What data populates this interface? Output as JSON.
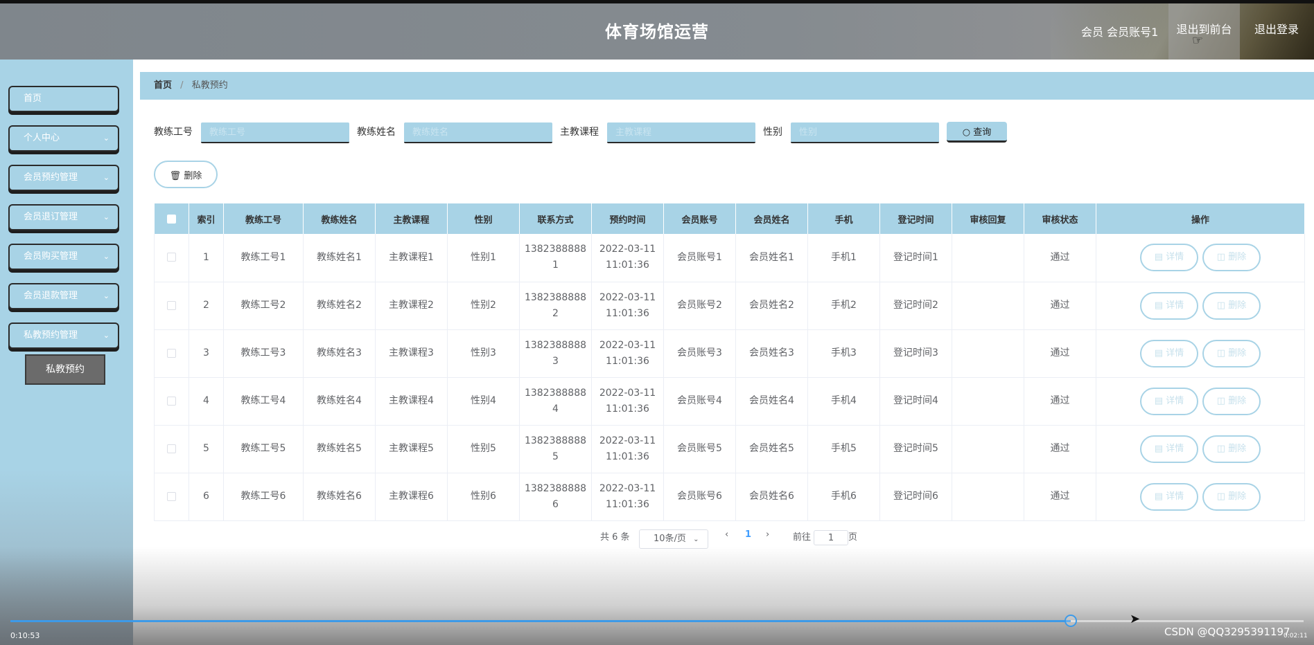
{
  "header": {
    "title": "体育场馆运营",
    "user_label": "会员 会员账号1",
    "front_label": "退出到前台",
    "logout_label": "退出登录"
  },
  "sidebar": {
    "items": [
      {
        "label": "首页"
      },
      {
        "label": "个人中心"
      },
      {
        "label": "会员预约管理"
      },
      {
        "label": "会员退订管理"
      },
      {
        "label": "会员购买管理"
      },
      {
        "label": "会员退款管理"
      },
      {
        "label": "私教预约管理"
      }
    ],
    "active_sub": "私教预约"
  },
  "breadcrumb": {
    "home": "首页",
    "separator": "/",
    "current": "私教预约"
  },
  "search": {
    "fields": [
      {
        "label": "教练工号",
        "placeholder": "教练工号"
      },
      {
        "label": "教练姓名",
        "placeholder": "教练姓名"
      },
      {
        "label": "主教课程",
        "placeholder": "主教课程"
      },
      {
        "label": "性别",
        "placeholder": "性别"
      }
    ],
    "query_label": "查询",
    "delete_label": "删除"
  },
  "table": {
    "headers": [
      "索引",
      "教练工号",
      "教练姓名",
      "主教课程",
      "性别",
      "联系方式",
      "预约时间",
      "会员账号",
      "会员姓名",
      "手机",
      "登记时间",
      "审核回复",
      "审核状态",
      "操作"
    ],
    "rows": [
      {
        "idx": "1",
        "no": "教练工号1",
        "name": "教练姓名1",
        "course": "主教课程1",
        "sex": "性别1",
        "phone_a": "1382388888",
        "phone_b": "1",
        "date": "2022-03-11",
        "time": "11:01:36",
        "acct": "会员账号1",
        "mname": "会员姓名1",
        "mobile": "手机1",
        "reg": "登记时间1",
        "reply": "",
        "status": "通过"
      },
      {
        "idx": "2",
        "no": "教练工号2",
        "name": "教练姓名2",
        "course": "主教课程2",
        "sex": "性别2",
        "phone_a": "1382388888",
        "phone_b": "2",
        "date": "2022-03-11",
        "time": "11:01:36",
        "acct": "会员账号2",
        "mname": "会员姓名2",
        "mobile": "手机2",
        "reg": "登记时间2",
        "reply": "",
        "status": "通过"
      },
      {
        "idx": "3",
        "no": "教练工号3",
        "name": "教练姓名3",
        "course": "主教课程3",
        "sex": "性别3",
        "phone_a": "1382388888",
        "phone_b": "3",
        "date": "2022-03-11",
        "time": "11:01:36",
        "acct": "会员账号3",
        "mname": "会员姓名3",
        "mobile": "手机3",
        "reg": "登记时间3",
        "reply": "",
        "status": "通过"
      },
      {
        "idx": "4",
        "no": "教练工号4",
        "name": "教练姓名4",
        "course": "主教课程4",
        "sex": "性别4",
        "phone_a": "1382388888",
        "phone_b": "4",
        "date": "2022-03-11",
        "time": "11:01:36",
        "acct": "会员账号4",
        "mname": "会员姓名4",
        "mobile": "手机4",
        "reg": "登记时间4",
        "reply": "",
        "status": "通过"
      },
      {
        "idx": "5",
        "no": "教练工号5",
        "name": "教练姓名5",
        "course": "主教课程5",
        "sex": "性别5",
        "phone_a": "1382388888",
        "phone_b": "5",
        "date": "2022-03-11",
        "time": "11:01:36",
        "acct": "会员账号5",
        "mname": "会员姓名5",
        "mobile": "手机5",
        "reg": "登记时间5",
        "reply": "",
        "status": "通过"
      },
      {
        "idx": "6",
        "no": "教练工号6",
        "name": "教练姓名6",
        "course": "主教课程6",
        "sex": "性别6",
        "phone_a": "1382388888",
        "phone_b": "6",
        "date": "2022-03-11",
        "time": "11:01:36",
        "acct": "会员账号6",
        "mname": "会员姓名6",
        "mobile": "手机6",
        "reg": "登记时间6",
        "reply": "",
        "status": "通过"
      }
    ],
    "detail_label": "详情",
    "row_delete_label": "删除"
  },
  "pagination": {
    "total": "共 6 条",
    "page_size": "10条/页",
    "current_page": "1",
    "goto_label": "前往",
    "goto_value": "1",
    "page_suffix": "页"
  },
  "player": {
    "current_time": "0:10:53",
    "total_time": "0:02:11",
    "progress": 0.82,
    "watermark": "CSDN @QQ3295391197"
  },
  "colors": {
    "accent": "#a8d3e6",
    "progress": "#3d9ae8"
  }
}
